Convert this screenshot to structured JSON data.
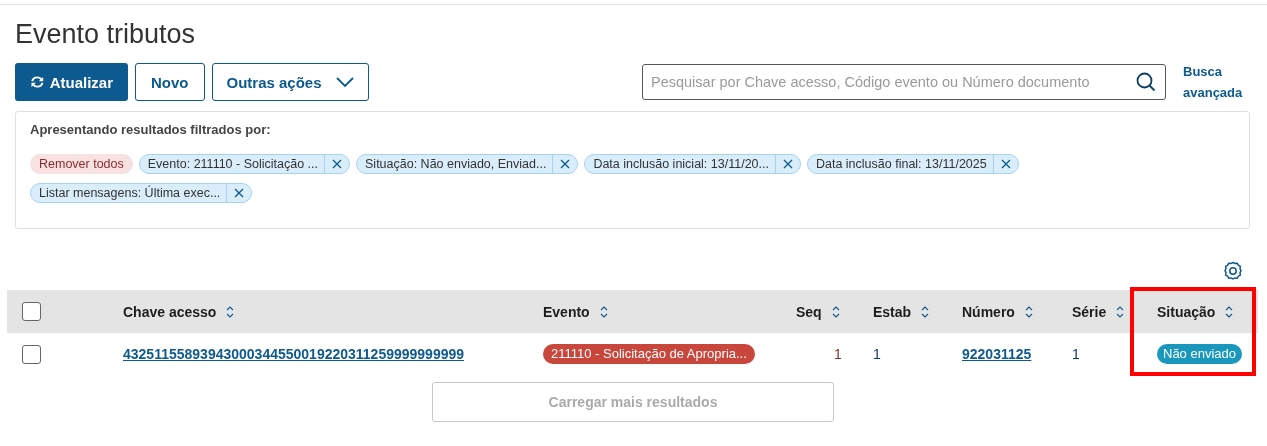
{
  "title": "Evento tributos",
  "toolbar": {
    "buttons": [
      {
        "label": "Atualizar",
        "kind": "primary"
      },
      {
        "label": "Novo",
        "kind": "secondary"
      },
      {
        "label": "Outras ações",
        "kind": "dropdown"
      }
    ],
    "search": {
      "placeholder": "Pesquisar por Chave acesso, Código evento ou Número documento"
    },
    "advanced_search": "Busca avançada"
  },
  "filters": {
    "caption": "Apresentando resultados filtrados por:",
    "chips": [
      {
        "label": "Remover todos",
        "kind": "remove_all"
      },
      {
        "label": "Evento: 211110 - Solicitação ...",
        "kind": "filter"
      },
      {
        "label": "Situação: Não enviado, Enviad...",
        "kind": "filter"
      },
      {
        "label": "Data inclusão inicial: 13/11/20...",
        "kind": "filter"
      },
      {
        "label": "Data inclusão final: 13/11/2025",
        "kind": "filter"
      },
      {
        "label": "Listar mensagens: Última exec...",
        "kind": "filter"
      }
    ]
  },
  "table": {
    "select_all": {
      "checked": false
    },
    "columns": [
      {
        "label": "Chave acesso",
        "highlighted": false
      },
      {
        "label": "Evento",
        "highlighted": false
      },
      {
        "label": "Seq",
        "highlighted": false
      },
      {
        "label": "Estab",
        "highlighted": false
      },
      {
        "label": "Número",
        "highlighted": false
      },
      {
        "label": "Série",
        "highlighted": false
      },
      {
        "label": "Situação",
        "highlighted": true
      }
    ],
    "rows": [
      {
        "checked": false,
        "chave_acesso": "43251155893943000344550019220311259999999999",
        "evento": {
          "label": "211110 - Solicitação de Apropria...",
          "color": "#c9463d"
        },
        "seq": "1",
        "estab": "1",
        "numero": "922031125",
        "serie": "1",
        "situacao": {
          "label": "Não enviado",
          "color": "#1a97bd"
        }
      }
    ]
  },
  "load_more": "Carregar mais resultados"
}
